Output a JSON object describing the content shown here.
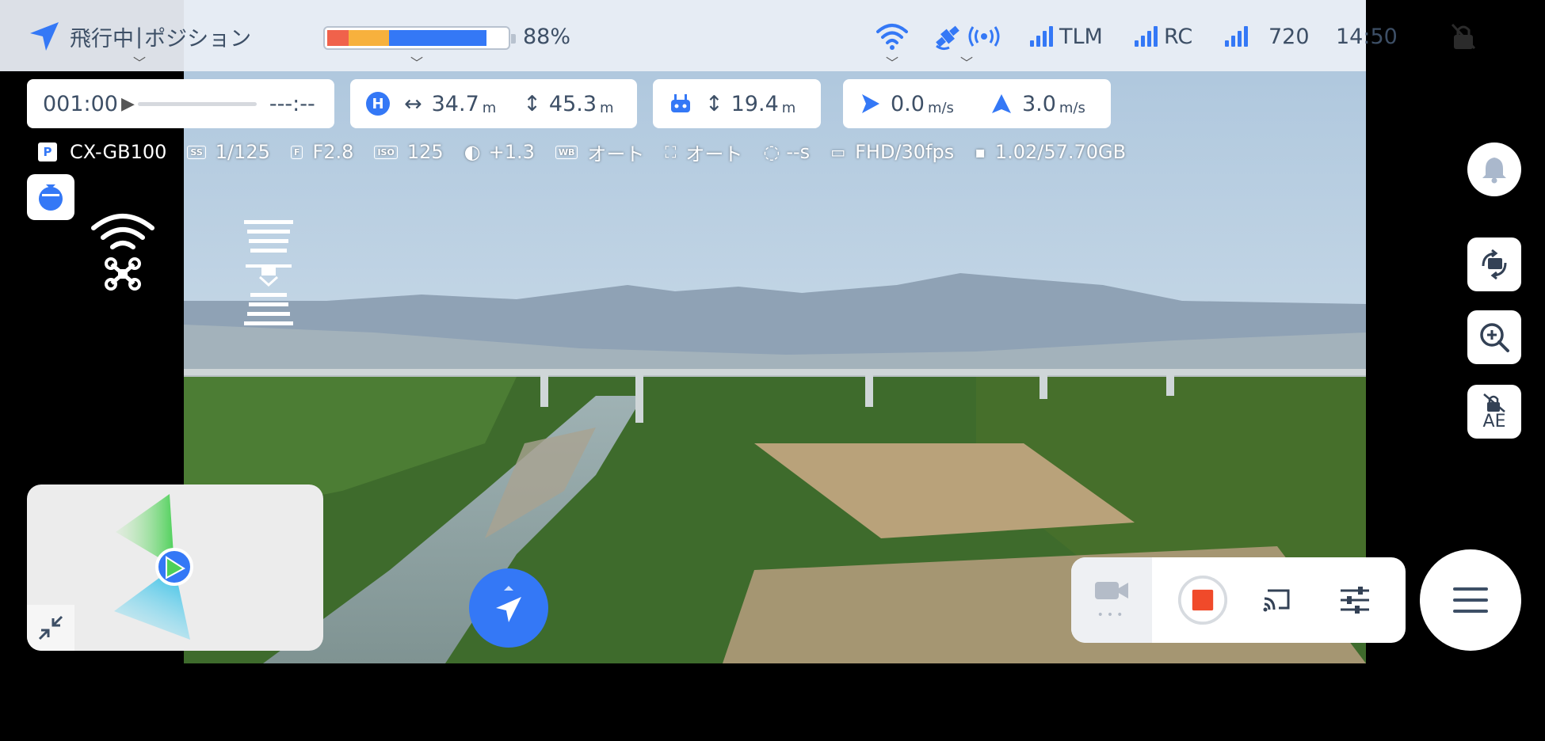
{
  "status": {
    "flight_state": "飛行中",
    "separator": "|",
    "flight_mode": "ポジション",
    "battery_percent": "88%",
    "battery_segments": {
      "red": 0.12,
      "yellow": 0.22,
      "blue": 0.54
    },
    "tlm_label": "TLM",
    "rc_label": "RC",
    "video_quality": "720",
    "time": "14:50"
  },
  "record": {
    "timer": "001:00",
    "remaining": "---:--"
  },
  "position": {
    "home_marker": "H",
    "distance": "34.7",
    "distance_unit": "m",
    "height": "45.3",
    "height_unit": "m"
  },
  "controller": {
    "height": "19.4",
    "height_unit": "m"
  },
  "speed": {
    "horizontal": "0.0",
    "horizontal_unit": "m/s",
    "vertical": "3.0",
    "vertical_unit": "m/s"
  },
  "camera": {
    "mode_badge": "P",
    "model": "CX-GB100",
    "shutter_icon": "SS",
    "shutter": "1/125",
    "aperture_icon": "F",
    "aperture": "F2.8",
    "iso_icon": "ISO",
    "iso": "125",
    "ev": "+1.3",
    "wb_icon": "WB",
    "wb": "オート",
    "focus": "オート",
    "interval": "--s",
    "video_format": "FHD/30fps",
    "storage": "1.02/57.70GB"
  },
  "buttons": {
    "ae_label": "AE",
    "more_dots": "•••"
  },
  "icons": {
    "flight_mode": "nav-arrow-icon",
    "wifi": "wifi-icon",
    "satellite": "satellite-icon",
    "tlm": "signal-bars-icon",
    "rc": "signal-bars-icon",
    "video": "signal-bars-icon",
    "lock": "lock-slash-icon",
    "bell": "bell-icon",
    "rotate": "camera-rotate-icon",
    "zoom": "zoom-in-icon",
    "ae_lock": "ae-lock-icon",
    "record": "record-icon",
    "cast": "cast-icon",
    "settings": "sliders-icon",
    "menu": "hamburger-icon"
  },
  "colors": {
    "accent": "#3478f6",
    "record_red": "#f04a2a",
    "battery_red": "#f0624b",
    "battery_yellow": "#f7b13d"
  }
}
